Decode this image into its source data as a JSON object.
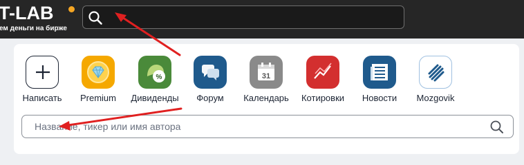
{
  "header": {
    "logo_text": "T-LAB",
    "logo_tagline": "ем деньги на бирже",
    "accent_color": "#f5a623",
    "search_icon": "search-icon"
  },
  "apps": [
    {
      "id": "write",
      "label": "Написать",
      "icon": "plus-icon"
    },
    {
      "id": "premium",
      "label": "Premium",
      "icon": "diamond-icon"
    },
    {
      "id": "dividends",
      "label": "Дивиденды",
      "icon": "dividends-bag-icon"
    },
    {
      "id": "forum",
      "label": "Форум",
      "icon": "chat-bubbles-icon"
    },
    {
      "id": "calendar",
      "label": "Календарь",
      "icon": "calendar-icon",
      "calendar_day": "31"
    },
    {
      "id": "quotes",
      "label": "Котировки",
      "icon": "chart-line-icon"
    },
    {
      "id": "news",
      "label": "Новости",
      "icon": "newspaper-icon"
    },
    {
      "id": "mozgovik",
      "label": "Mozgovik",
      "icon": "mozgovik-logo-icon"
    }
  ],
  "search": {
    "placeholder": "Название, тикер или имя автора"
  },
  "colors": {
    "premium": "#f5a800",
    "dividends": "#4a8a3a",
    "forum": "#1f5a8c",
    "calendar": "#8a8a8a",
    "quotes": "#d32f2f",
    "news": "#1f5a8c",
    "annotation_arrow": "#e02020"
  }
}
